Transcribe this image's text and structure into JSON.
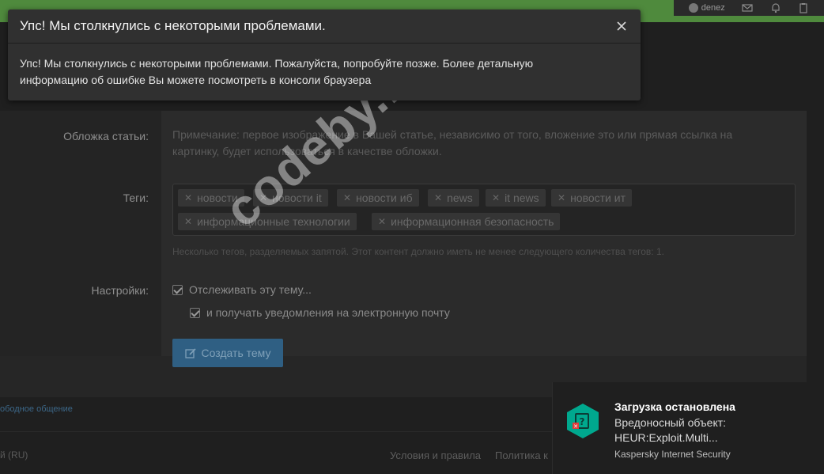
{
  "header": {
    "username": "denez"
  },
  "form": {
    "cover_label": "Обложка статьи:",
    "cover_hint": "Примечание: первое изображение в Вашей статье, независимо от того, вложение это или прямая ссылка на картинку, будет использоваться в качестве обложки.",
    "tags_label": "Теги:",
    "tags": [
      "новости",
      "новости it",
      "новости иб",
      "news",
      "it news",
      "новости ит",
      "информационные технологии",
      "информационная безопасность"
    ],
    "tags_hint": "Несколько тегов, разделяемых запятой. Этот контент должно иметь не менее следующего количества тегов: 1.",
    "settings_label": "Настройки:",
    "watch_label": "Отслеживать эту тему...",
    "email_label": "и получать уведомления на электронную почту",
    "submit_label": "Создать тему"
  },
  "footer": {
    "forum_link": "ободное общение",
    "language": "й (RU)",
    "terms_link": "Условия и правила",
    "policy_link": "Политика к"
  },
  "watermark": "codeby.net",
  "modal": {
    "title": "Упс! Мы столкнулись с некоторыми проблемами.",
    "body": "Упс! Мы столкнулись с некоторыми проблемами. Пожалуйста, попробуйте позже. Более детальную информацию об ошибке Вы можете посмотреть в консоли браузера"
  },
  "toast": {
    "title": "Загрузка остановлена",
    "line1": "Вредоносный объект:",
    "line2": "HEUR:Exploit.Multi...",
    "source": "Kaspersky Internet Security"
  },
  "colors": {
    "topbar_green": "#4f8a3d",
    "modal_bg": "#303030",
    "button_blue": "#2f5f83",
    "kaspersky_teal": "#00a88e"
  }
}
